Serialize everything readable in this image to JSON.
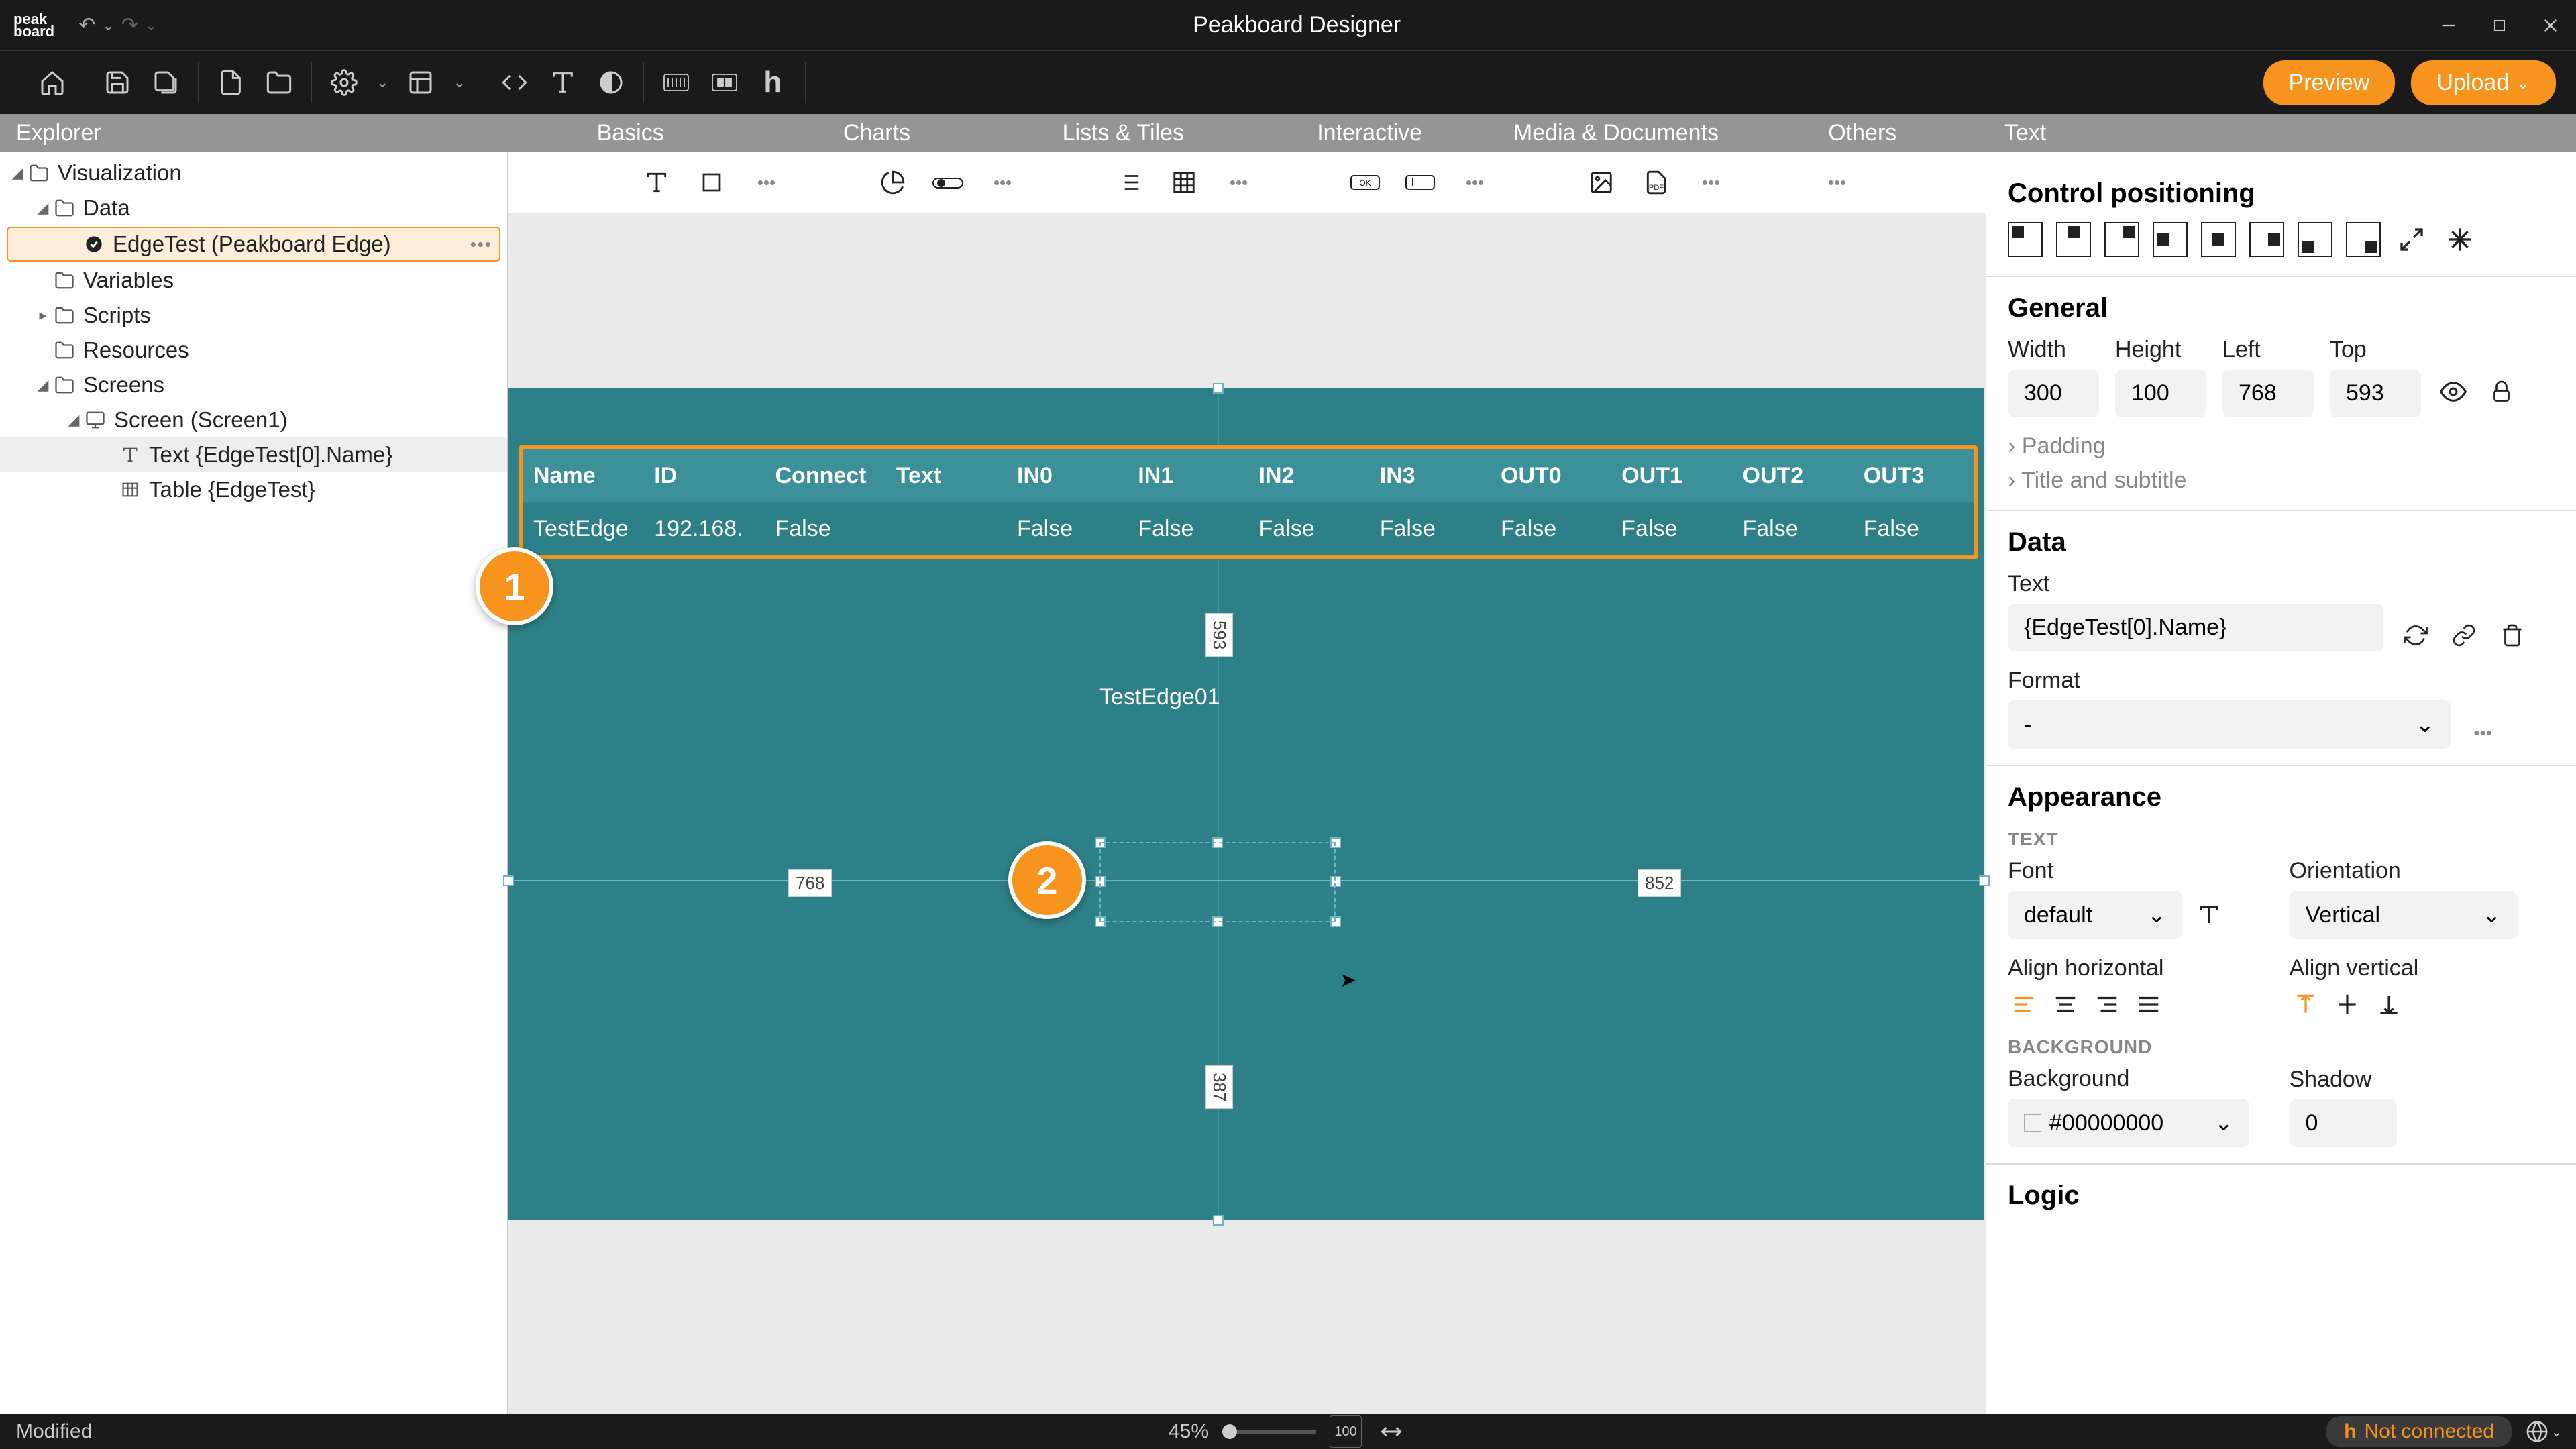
{
  "app_title": "Peakboard Designer",
  "logo": "peakboard",
  "toolbar_buttons": {
    "preview": "Preview",
    "upload": "Upload"
  },
  "tabstrip": {
    "explorer": "Explorer",
    "basics": "Basics",
    "charts": "Charts",
    "lists": "Lists & Tiles",
    "interactive": "Interactive",
    "media": "Media & Documents",
    "others": "Others",
    "text": "Text"
  },
  "explorer": {
    "root": "Visualization",
    "data": "Data",
    "data_item": "EdgeTest (Peakboard Edge)",
    "variables": "Variables",
    "scripts": "Scripts",
    "resources": "Resources",
    "screens": "Screens",
    "screen1": "Screen (Screen1)",
    "text_item": "Text {EdgeTest[0].Name}",
    "table_item": "Table {EdgeTest}"
  },
  "canvas": {
    "table": {
      "headers": [
        "Name",
        "ID",
        "Connect",
        "Text",
        "IN0",
        "IN1",
        "IN2",
        "IN3",
        "OUT0",
        "OUT1",
        "OUT2",
        "OUT3"
      ],
      "row": [
        "TestEdge",
        "192.168.",
        "False",
        "",
        "False",
        "False",
        "False",
        "False",
        "False",
        "False",
        "False",
        "False"
      ]
    },
    "text_value": "TestEdge01",
    "guides": {
      "left": "768",
      "right": "852",
      "top": "593",
      "bottom": "387"
    },
    "annotations": {
      "a1": "1",
      "a2": "2"
    }
  },
  "props": {
    "control_positioning": "Control positioning",
    "general": "General",
    "width_label": "Width",
    "width": "300",
    "height_label": "Height",
    "height": "100",
    "left_label": "Left",
    "left": "768",
    "top_label": "Top",
    "top": "593",
    "padding": "Padding",
    "title_sub": "Title and subtitle",
    "data_section": "Data",
    "text_label": "Text",
    "text_value": "{EdgeTest[0].Name}",
    "format_label": "Format",
    "format_value": "-",
    "appearance": "Appearance",
    "text_sub": "TEXT",
    "font_label": "Font",
    "font_value": "default",
    "orientation_label": "Orientation",
    "orientation_value": "Vertical",
    "alignh_label": "Align horizontal",
    "alignv_label": "Align vertical",
    "background_sub": "BACKGROUND",
    "background_label": "Background",
    "background_value": "#00000000",
    "shadow_label": "Shadow",
    "shadow_value": "0",
    "logic": "Logic"
  },
  "statusbar": {
    "modified": "Modified",
    "zoom": "45%",
    "not_connected": "Not connected"
  }
}
